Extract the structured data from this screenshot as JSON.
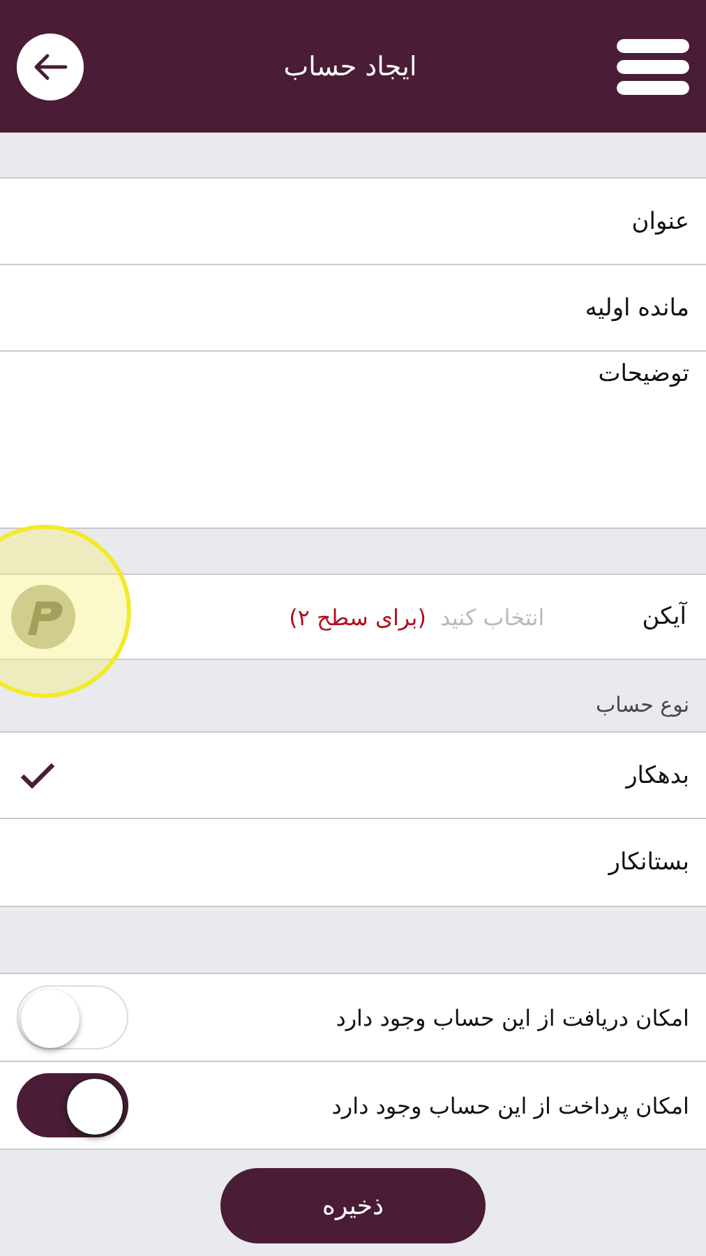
{
  "header": {
    "title": "ایجاد حساب"
  },
  "fields": [
    {
      "label": "عنوان",
      "kind": "line"
    },
    {
      "label": "مانده اولیه",
      "kind": "line"
    },
    {
      "label": "توضیحات",
      "kind": "area"
    }
  ],
  "icon_row": {
    "label": "آیکن",
    "placeholder": "انتخاب کنید",
    "note": "(برای سطح ۲)",
    "touch_highlight": true
  },
  "account_type": {
    "label": "نوع حساب",
    "options": [
      {
        "label": "بدهکار",
        "selected": true
      },
      {
        "label": "بستانکار",
        "selected": false
      }
    ]
  },
  "toggles": [
    {
      "label": "امکان دریافت از این حساب وجود دارد",
      "on": false
    },
    {
      "label": "امکان پرداخت از این حساب وجود دارد",
      "on": true
    }
  ],
  "save_button": "ذخیره"
}
